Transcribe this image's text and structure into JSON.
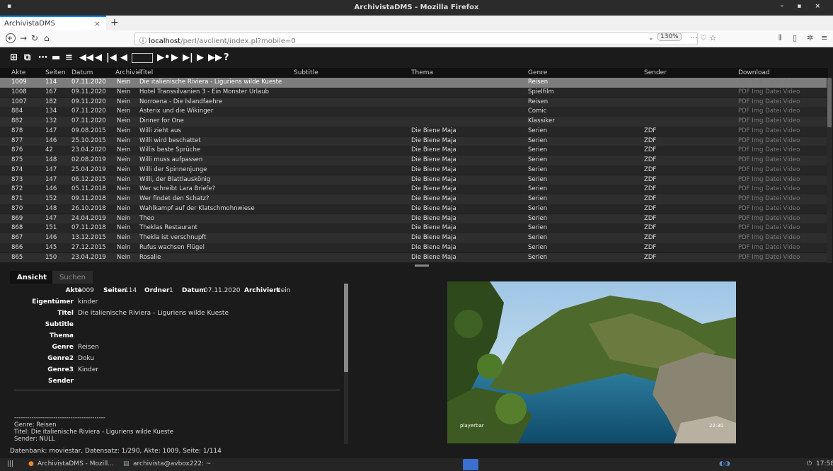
{
  "window": {
    "title": "ArchivistaDMS - Mozilla Firefox",
    "sysmenu": "▪",
    "controls": "– ▪ ×"
  },
  "browser": {
    "tab_label": "ArchivistaDMS",
    "tab_close": "×",
    "new_tab": "+",
    "url_host": "localhost",
    "url_path": "/perl/avclient/index.pl?mobile=0",
    "zoom": "130%",
    "page_actions": "··· ♡ ☆",
    "icons": {
      "back": "back-arrow-icon",
      "forward": "forward-arrow-icon",
      "reload": "reload-icon",
      "home": "home-icon",
      "info": "info-icon",
      "library": "library-icon",
      "sidebar": "sidebar-icon",
      "extension": "extension-icon",
      "menu": "hamburger-menu-icon"
    }
  },
  "toolbar": {
    "buttons": [
      "login-icon",
      "copy-icon",
      "view-icon",
      "edit-icon",
      "select-icon",
      "first-page-icon",
      "prev-page-icon",
      "first-record-icon",
      "prev-record-icon",
      "next-record-icon",
      "next-page-icon",
      "last-record-icon",
      "last-page-icon",
      "fast-forward-icon",
      "help-icon"
    ],
    "help_label": "?"
  },
  "grid": {
    "columns": [
      "Akte",
      "Seiten",
      "Datum",
      "Archivie",
      "Titel",
      "Subtitle",
      "Thema",
      "Genre",
      "Sender",
      "Download"
    ],
    "download_label": "PDF Img Datei Video",
    "rows": [
      {
        "akte": "1009",
        "seiten": "114",
        "datum": "07.11.2020",
        "arch": "Nein",
        "titel": "Die italienische Riviera - Liguriens wilde Kueste",
        "thema": "",
        "genre": "Reisen",
        "sender": ""
      },
      {
        "akte": "1008",
        "seiten": "167",
        "datum": "09.11.2020",
        "arch": "Nein",
        "titel": "Hotel Transsilvanien 3 - Ein Monster Urlaub",
        "thema": "",
        "genre": "Spielfilm",
        "sender": ""
      },
      {
        "akte": "1007",
        "seiten": "182",
        "datum": "09.11.2020",
        "arch": "Nein",
        "titel": "Norroena - Die Islandfaehre",
        "thema": "",
        "genre": "Reisen",
        "sender": ""
      },
      {
        "akte": "884",
        "seiten": "134",
        "datum": "07.11.2020",
        "arch": "Nein",
        "titel": "Asterix und die Wikinger",
        "thema": "",
        "genre": "Comic",
        "sender": ""
      },
      {
        "akte": "882",
        "seiten": "132",
        "datum": "07.11.2020",
        "arch": "Nein",
        "titel": "Dinner for One",
        "thema": "",
        "genre": "Klassiker",
        "sender": ""
      },
      {
        "akte": "878",
        "seiten": "147",
        "datum": "09.08.2015",
        "arch": "Nein",
        "titel": "Willi zieht aus",
        "thema": "Die Biene Maja",
        "genre": "Serien",
        "sender": "ZDF"
      },
      {
        "akte": "877",
        "seiten": "146",
        "datum": "25.10.2015",
        "arch": "Nein",
        "titel": "Willi wird beschattet",
        "thema": "Die Biene Maja",
        "genre": "Serien",
        "sender": "ZDF"
      },
      {
        "akte": "876",
        "seiten": "42",
        "datum": "23.04.2020",
        "arch": "Nein",
        "titel": "Willis beste Sprüche",
        "thema": "Die Biene Maja",
        "genre": "Serien",
        "sender": "ZDF"
      },
      {
        "akte": "875",
        "seiten": "148",
        "datum": "02.08.2019",
        "arch": "Nein",
        "titel": "Willi muss aufpassen",
        "thema": "Die Biene Maja",
        "genre": "Serien",
        "sender": "ZDF"
      },
      {
        "akte": "874",
        "seiten": "147",
        "datum": "25.04.2019",
        "arch": "Nein",
        "titel": "Willi der Spinnenjunge",
        "thema": "Die Biene Maja",
        "genre": "Serien",
        "sender": "ZDF"
      },
      {
        "akte": "873",
        "seiten": "147",
        "datum": "06.12.2015",
        "arch": "Nein",
        "titel": "Willi, der Blattlauskönig",
        "thema": "Die Biene Maja",
        "genre": "Serien",
        "sender": "ZDF"
      },
      {
        "akte": "872",
        "seiten": "146",
        "datum": "05.11.2018",
        "arch": "Nein",
        "titel": "Wer schreibt Lara Briefe?",
        "thema": "Die Biene Maja",
        "genre": "Serien",
        "sender": "ZDF"
      },
      {
        "akte": "871",
        "seiten": "152",
        "datum": "09.11.2018",
        "arch": "Nein",
        "titel": "Wer findet den Schatz?",
        "thema": "Die Biene Maja",
        "genre": "Serien",
        "sender": "ZDF"
      },
      {
        "akte": "870",
        "seiten": "148",
        "datum": "26.10.2018",
        "arch": "Nein",
        "titel": "Wahlkampf auf der Klatschmohnwiese",
        "thema": "Die Biene Maja",
        "genre": "Serien",
        "sender": "ZDF"
      },
      {
        "akte": "869",
        "seiten": "147",
        "datum": "24.04.2019",
        "arch": "Nein",
        "titel": "Theo",
        "thema": "Die Biene Maja",
        "genre": "Serien",
        "sender": "ZDF"
      },
      {
        "akte": "868",
        "seiten": "151",
        "datum": "07.11.2018",
        "arch": "Nein",
        "titel": "Theklas Restaurant",
        "thema": "Die Biene Maja",
        "genre": "Serien",
        "sender": "ZDF"
      },
      {
        "akte": "867",
        "seiten": "146",
        "datum": "13.12.2015",
        "arch": "Nein",
        "titel": "Thekla ist verschnupft",
        "thema": "Die Biene Maja",
        "genre": "Serien",
        "sender": "ZDF"
      },
      {
        "akte": "866",
        "seiten": "145",
        "datum": "27.12.2015",
        "arch": "Nein",
        "titel": "Rufus wachsen Flügel",
        "thema": "Die Biene Maja",
        "genre": "Serien",
        "sender": "ZDF"
      },
      {
        "akte": "865",
        "seiten": "150",
        "datum": "23.04.2019",
        "arch": "Nein",
        "titel": "Rosalie",
        "thema": "Die Biene Maja",
        "genre": "Serien",
        "sender": "ZDF"
      }
    ]
  },
  "panel": {
    "tabs": [
      "Ansicht",
      "Suchen"
    ],
    "fields": {
      "akte_label": "Akte",
      "akte": "1009",
      "seiten_label": "Seiten",
      "seiten": "114",
      "ordner_label": "Ordner",
      "ordner": "1",
      "datum_label": "Datum",
      "datum": "07.11.2020",
      "archiviert_label": "Archiviert",
      "archiviert": "Nein",
      "eigentuemer_label": "Eigentümer",
      "eigentuemer": "kinder",
      "titel_label": "Titel",
      "titel": "Die italienische Riviera - Liguriens wilde Kueste",
      "subtitle_label": "Subtitle",
      "thema_label": "Thema",
      "genre_label": "Genre",
      "genre": "Reisen",
      "genre2_label": "Genre2",
      "genre2": "Doku",
      "genre3_label": "Genre3",
      "genre3": "Kinder",
      "sender_label": "Sender"
    },
    "notes": {
      "sep": "------------------------------------------",
      "line1": "Genre: Reisen",
      "line2": "Titel: Die italienische Riviera - Liguriens wilde Kueste",
      "line3": "Sender: NULL"
    },
    "image": {
      "overlay_left": "playerbar",
      "overlay_right": "22:30"
    }
  },
  "status": "Datenbank: moviestar, Datensatz: 1/290, Akte: 1009, Seite: 1/114",
  "taskbar": {
    "menu": "|||",
    "item1": "ArchivistaDMS - Mozill...",
    "item2": "archivista@avbox222: ~",
    "clock": "17:58"
  }
}
